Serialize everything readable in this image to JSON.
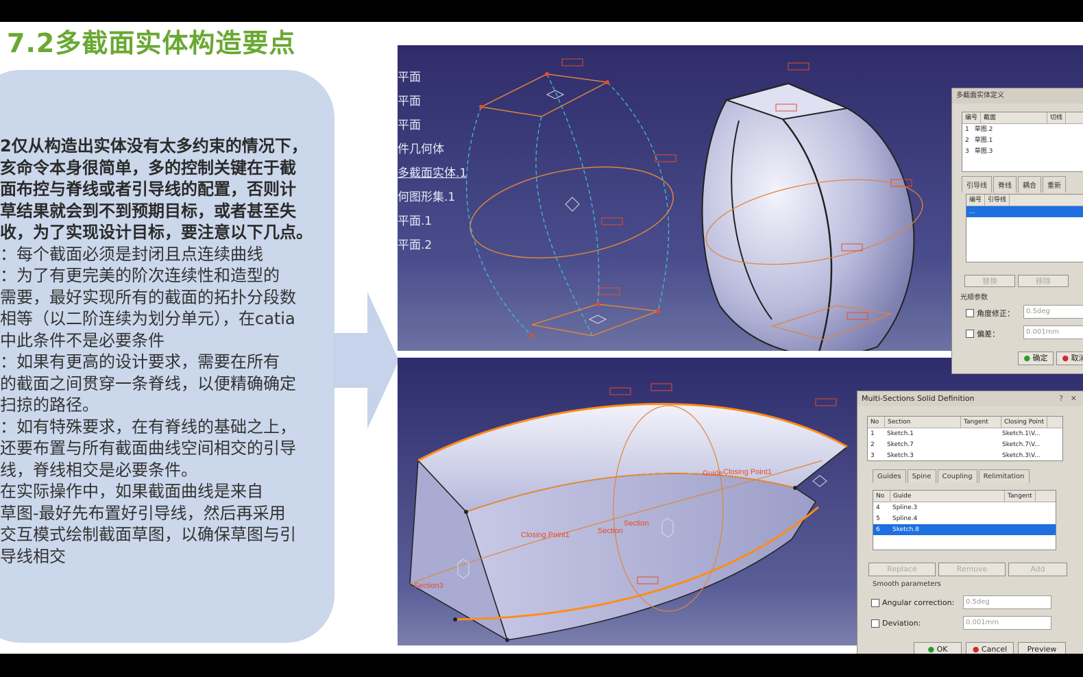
{
  "slide": {
    "title": "7.2多截面实体构造要点",
    "body_lines": [
      {
        "text": "2仅从构造出实体没有太多约束的情况下，",
        "bold": true
      },
      {
        "text": "亥命令本身很简单，多的控制关键在于截",
        "bold": true
      },
      {
        "text": "面布控与脊线或者引导线的配置，否则计",
        "bold": true
      },
      {
        "text": "草结果就会到不到预期目标，或者甚至失",
        "bold": true
      },
      {
        "text": "收，为了实现设计目标，要注意以下几点。",
        "bold": true
      },
      {
        "text": "：每个截面必须是封闭且点连续曲线",
        "bold": false
      },
      {
        "text": "：为了有更完美的阶次连续性和造型的",
        "bold": false
      },
      {
        "text": "需要，最好实现所有的截面的拓扑分段数",
        "bold": false
      },
      {
        "text": "相等（以二阶连续为划分单元），在catia",
        "bold": false
      },
      {
        "text": "中此条件不是必要条件",
        "bold": false
      },
      {
        "text": "：如果有更高的设计要求，需要在所有",
        "bold": false
      },
      {
        "text": "的截面之间贯穿一条脊线，以便精确确定",
        "bold": false
      },
      {
        "text": "扫掠的路径。",
        "bold": false
      },
      {
        "text": "：如有特殊要求，在有脊线的基础之上，",
        "bold": false
      },
      {
        "text": "还要布置与所有截面曲线空间相交的引导",
        "bold": false
      },
      {
        "text": "线，脊线相交是必要条件。",
        "bold": false
      },
      {
        "text": "   在实际操作中，如果截面曲线是来自",
        "bold": false
      },
      {
        "text": "草图-最好先布置好引导线，然后再采用",
        "bold": false
      },
      {
        "text": "交互模式绘制截面草图，以确保草图与引",
        "bold": false
      },
      {
        "text": "导线相交",
        "bold": false
      }
    ]
  },
  "viewport_top": {
    "tree_items": [
      "平面",
      "平面",
      "平面",
      "件几何体",
      "多截面实体.1",
      "何图形集.1",
      "平面.1",
      "平面.2"
    ]
  },
  "dialog_cn": {
    "title": "多截面实体定义",
    "list_headers": [
      "编号",
      "截面",
      "切线"
    ],
    "rows": [
      [
        "1",
        "草图.2"
      ],
      [
        "2",
        "草图.1"
      ],
      [
        "3",
        "草图.3"
      ]
    ],
    "tabs": [
      "引导线",
      "脊线",
      "耦合",
      "重新"
    ],
    "guide_headers": [
      "编号",
      "引导线"
    ],
    "buttons": [
      "替换",
      "移除"
    ],
    "smooth_label": "光顺参数",
    "angular_label": "角度修正：",
    "angular_value": "0.5deg",
    "deviation_label": "偏差：",
    "deviation_value": "0.001mm",
    "ok": "确定",
    "cancel": "取消"
  },
  "dialog_en": {
    "title": "Multi-Sections Solid Definition",
    "section_headers": [
      "No",
      "Section",
      "Tangent",
      "Closing Point"
    ],
    "section_rows": [
      [
        "1",
        "Sketch.1",
        "",
        "Sketch.1\\V..."
      ],
      [
        "2",
        "Sketch.7",
        "",
        "Sketch.7\\V..."
      ],
      [
        "3",
        "Sketch.3",
        "",
        "Sketch.3\\V..."
      ]
    ],
    "tabs": [
      "Guides",
      "Spine",
      "Coupling",
      "Relimitation"
    ],
    "guide_headers": [
      "No",
      "Guide",
      "Tangent"
    ],
    "guide_rows": [
      [
        "4",
        "Spline.3"
      ],
      [
        "5",
        "Spline.4"
      ],
      [
        "6",
        "Sketch.8"
      ]
    ],
    "buttons": [
      "Replace",
      "Remove",
      "Add"
    ],
    "smooth_label": "Smooth parameters",
    "angular_label": "Angular correction:",
    "angular_value": "0.5deg",
    "deviation_label": "Deviation:",
    "deviation_value": "0.001mm",
    "ok": "OK",
    "cancel": "Cancel",
    "preview": "Preview"
  },
  "model_labels": {
    "closing_point": "Closing Point1",
    "section_a": "Section",
    "section_3": "Section3",
    "guide": "Guide"
  }
}
